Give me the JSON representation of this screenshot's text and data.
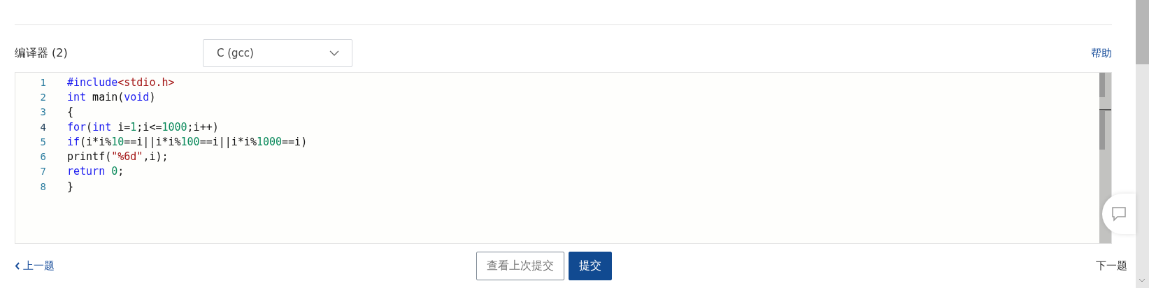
{
  "compiler": {
    "label": "编译器 (2)",
    "value": "C (gcc)"
  },
  "help_link": "帮助",
  "editor": {
    "lines": [
      {
        "number": "1",
        "active": false,
        "tokens": [
          {
            "kind": "meta",
            "text": "#include"
          },
          {
            "kind": "string",
            "text": "<stdio.h>"
          }
        ]
      },
      {
        "number": "2",
        "active": false,
        "tokens": [
          {
            "kind": "keyword",
            "text": "int"
          },
          {
            "kind": "plain",
            "text": " main("
          },
          {
            "kind": "keyword",
            "text": "void"
          },
          {
            "kind": "plain",
            "text": ")"
          }
        ]
      },
      {
        "number": "3",
        "active": false,
        "tokens": [
          {
            "kind": "plain",
            "text": "{"
          }
        ]
      },
      {
        "number": "4",
        "active": true,
        "tokens": [
          {
            "kind": "keyword",
            "text": "for"
          },
          {
            "kind": "plain",
            "text": "("
          },
          {
            "kind": "keyword",
            "text": "int"
          },
          {
            "kind": "plain",
            "text": " i="
          },
          {
            "kind": "number",
            "text": "1"
          },
          {
            "kind": "plain",
            "text": ";i<="
          },
          {
            "kind": "number",
            "text": "1000"
          },
          {
            "kind": "plain",
            "text": ";i++)"
          }
        ]
      },
      {
        "number": "5",
        "active": false,
        "tokens": [
          {
            "kind": "keyword",
            "text": "if"
          },
          {
            "kind": "plain",
            "text": "(i*i%"
          },
          {
            "kind": "number",
            "text": "10"
          },
          {
            "kind": "plain",
            "text": "==i||i*i%"
          },
          {
            "kind": "number",
            "text": "100"
          },
          {
            "kind": "plain",
            "text": "==i||i*i%"
          },
          {
            "kind": "number",
            "text": "1000"
          },
          {
            "kind": "plain",
            "text": "==i)"
          }
        ]
      },
      {
        "number": "6",
        "active": false,
        "tokens": [
          {
            "kind": "plain",
            "text": "printf("
          },
          {
            "kind": "string",
            "text": "\"%6d\""
          },
          {
            "kind": "plain",
            "text": ",i);"
          }
        ]
      },
      {
        "number": "7",
        "active": false,
        "tokens": [
          {
            "kind": "keyword",
            "text": "return"
          },
          {
            "kind": "number",
            "text": " 0"
          },
          {
            "kind": "plain",
            "text": ";"
          }
        ]
      },
      {
        "number": "8",
        "active": false,
        "tokens": [
          {
            "kind": "plain",
            "text": "}"
          }
        ]
      }
    ]
  },
  "footer": {
    "prev": "上一题",
    "view_last": "查看上次提交",
    "submit": "提交",
    "next": "下一题"
  }
}
